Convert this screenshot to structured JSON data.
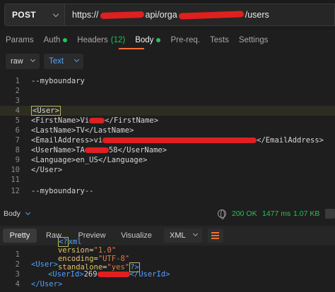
{
  "request": {
    "method": "POST",
    "url_prefix": "https://",
    "url_mid": "api/orga",
    "url_suffix": "/users"
  },
  "tabs": [
    {
      "label": "Params"
    },
    {
      "label": "Auth"
    },
    {
      "label": "Headers",
      "count": "(12)"
    },
    {
      "label": "Body"
    },
    {
      "label": "Pre-req."
    },
    {
      "label": "Tests"
    },
    {
      "label": "Settings"
    }
  ],
  "body_toolbar": {
    "mode": "raw",
    "format": "Text"
  },
  "editor_lines": [
    {
      "n": "1",
      "text": "--myboundary"
    },
    {
      "n": "2",
      "text": ""
    },
    {
      "n": "3",
      "text": ""
    },
    {
      "n": "4",
      "text": "<User>"
    },
    {
      "n": "5",
      "pre": "<FirstName>Vi",
      "post": "</FirstName>"
    },
    {
      "n": "6",
      "text": "<LastName>TV</LastName>"
    },
    {
      "n": "7",
      "pre": "<EmailAddress>vi",
      "post": "</EmailAddress>"
    },
    {
      "n": "8",
      "pre": "<UserName>TA",
      "post": "58</UserName>"
    },
    {
      "n": "9",
      "text": "<Language>en_US</Language>"
    },
    {
      "n": "10",
      "text": "</User>"
    },
    {
      "n": "11",
      "text": ""
    },
    {
      "n": "12",
      "text": "--myboundary--"
    }
  ],
  "response": {
    "section_label": "Body",
    "status": "200 OK",
    "time": "1477 ms",
    "size": "1.07 KB",
    "tabs": [
      "Pretty",
      "Raw",
      "Preview",
      "Visualize"
    ],
    "format": "XML",
    "lines": [
      {
        "n": "1",
        "decl_open": "<?",
        "decl_name": "xml",
        "attr1": "version",
        "val1": "\"1.0\"",
        "attr2": "encoding",
        "val2": "\"UTF-8\"",
        "attr3": "standalone",
        "val3": "\"yes\"",
        "decl_close": "?>"
      },
      {
        "n": "2",
        "tag": "<User>"
      },
      {
        "n": "3",
        "open": "<UserId>",
        "value": "269",
        "close": "</UserId>"
      },
      {
        "n": "4",
        "tag": "</User>"
      }
    ]
  },
  "colors": {
    "accent": "#ff6c37",
    "success": "#2dbe5a",
    "link": "#4fa3ff",
    "redaction": "#e01f1f"
  }
}
